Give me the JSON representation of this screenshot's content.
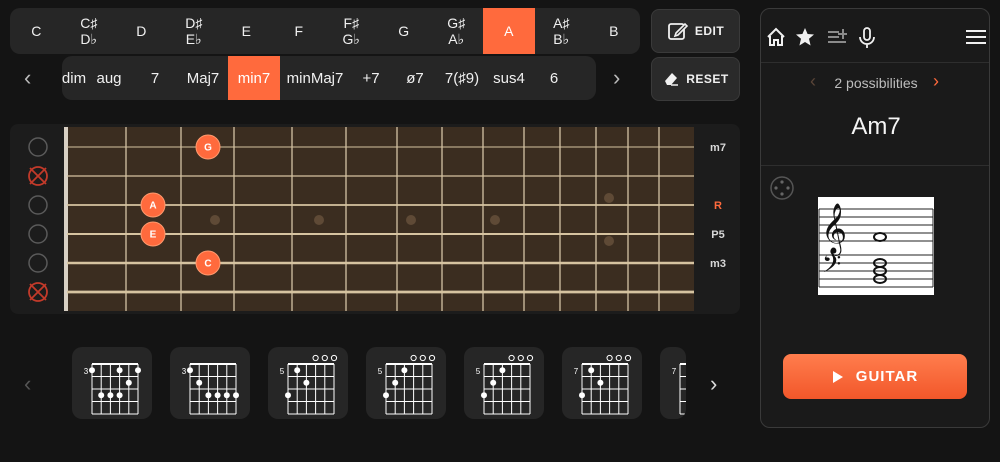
{
  "root_notes": [
    {
      "top": "C",
      "bottom": ""
    },
    {
      "top": "C♯",
      "bottom": "D♭"
    },
    {
      "top": "D",
      "bottom": ""
    },
    {
      "top": "D♯",
      "bottom": "E♭"
    },
    {
      "top": "E",
      "bottom": ""
    },
    {
      "top": "F",
      "bottom": ""
    },
    {
      "top": "F♯",
      "bottom": "G♭"
    },
    {
      "top": "G",
      "bottom": ""
    },
    {
      "top": "G♯",
      "bottom": "A♭"
    },
    {
      "top": "A",
      "bottom": ""
    },
    {
      "top": "A♯",
      "bottom": "B♭"
    },
    {
      "top": "B",
      "bottom": ""
    }
  ],
  "selected_root": "A",
  "qualities": [
    "dim",
    "aug",
    "7",
    "Maj7",
    "min7",
    "minMaj7",
    "+7",
    "ø7",
    "7(♯9)",
    "sus4",
    "6"
  ],
  "selected_quality": "min7",
  "buttons": {
    "edit": "EDIT",
    "reset": "RESET"
  },
  "fretboard": {
    "interval_labels": [
      "m7",
      "",
      "R",
      "P5",
      "m3",
      ""
    ],
    "notes": [
      {
        "label": "G",
        "string": 1,
        "fret": 3
      },
      {
        "label": "A",
        "string": 3,
        "fret": 2
      },
      {
        "label": "E",
        "string": 4,
        "fret": 2
      },
      {
        "label": "C",
        "string": 5,
        "fret": 3
      }
    ],
    "open_strings": [
      1,
      3,
      4,
      5
    ],
    "muted_strings": [
      2,
      6
    ]
  },
  "voicings": [
    {
      "fret": "3",
      "opens": 0
    },
    {
      "fret": "3",
      "opens": 0
    },
    {
      "fret": "5",
      "opens": 3
    },
    {
      "fret": "5",
      "opens": 3
    },
    {
      "fret": "5",
      "opens": 3
    },
    {
      "fret": "7",
      "opens": 3
    },
    {
      "fret": "7",
      "opens": 0
    }
  ],
  "panel": {
    "possibilities": "2 possibilities",
    "chord_name": "Am7",
    "guitar_label": "GUITAR"
  },
  "colors": {
    "accent": "#ff6a3d",
    "panel": "#262626",
    "background": "#141414"
  }
}
